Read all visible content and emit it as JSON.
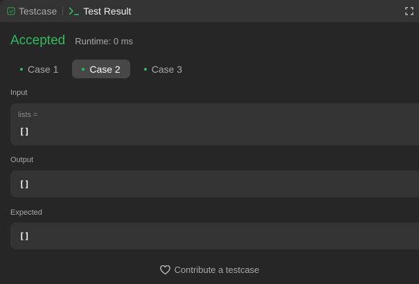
{
  "header": {
    "tabs": [
      {
        "label": "Testcase",
        "icon": "checkbox-icon"
      },
      {
        "label": "Test Result",
        "icon": "terminal-icon"
      }
    ],
    "expand_icon": "fullscreen-icon"
  },
  "result": {
    "status": "Accepted",
    "runtime": "Runtime: 0 ms"
  },
  "cases": [
    {
      "label": "Case 1"
    },
    {
      "label": "Case 2",
      "active": true
    },
    {
      "label": "Case 3"
    }
  ],
  "input": {
    "label": "Input",
    "var": "lists =",
    "value": "[]"
  },
  "output": {
    "label": "Output",
    "value": "[]"
  },
  "expected": {
    "label": "Expected",
    "value": "[]"
  },
  "contribute": "Contribute a testcase",
  "colors": {
    "accent": "#2cbb5d",
    "bg": "#262626",
    "card": "#333333"
  }
}
